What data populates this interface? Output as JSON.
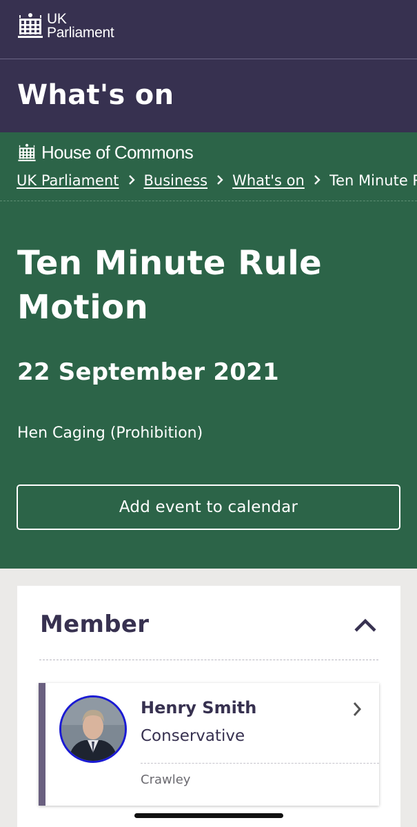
{
  "header": {
    "logo_line1": "UK",
    "logo_line2": "Parliament",
    "section_title": "What's on"
  },
  "house": {
    "name": "House of Commons"
  },
  "breadcrumb": {
    "items": [
      "UK Parliament",
      "Business",
      "What's on"
    ],
    "current": "Ten Minute Rule Motion",
    "separator_icon": "chevron-right-icon"
  },
  "event": {
    "title": "Ten Minute Rule Motion",
    "date": "22 September 2021",
    "subject": "Hen Caging (Prohibition)",
    "calendar_button": "Add event to calendar"
  },
  "member_section": {
    "heading": "Member",
    "toggle_icon": "chevron-up-icon",
    "member": {
      "name": "Henry Smith",
      "party": "Conservative",
      "constituency": "Crawley",
      "party_color": "#6a6080",
      "avatar_ring_color": "#1a1ad4",
      "link_icon": "chevron-right-icon"
    }
  },
  "colors": {
    "header_bg": "#373150",
    "commons_green": "#2c6448",
    "page_bg": "#ebeae8"
  }
}
